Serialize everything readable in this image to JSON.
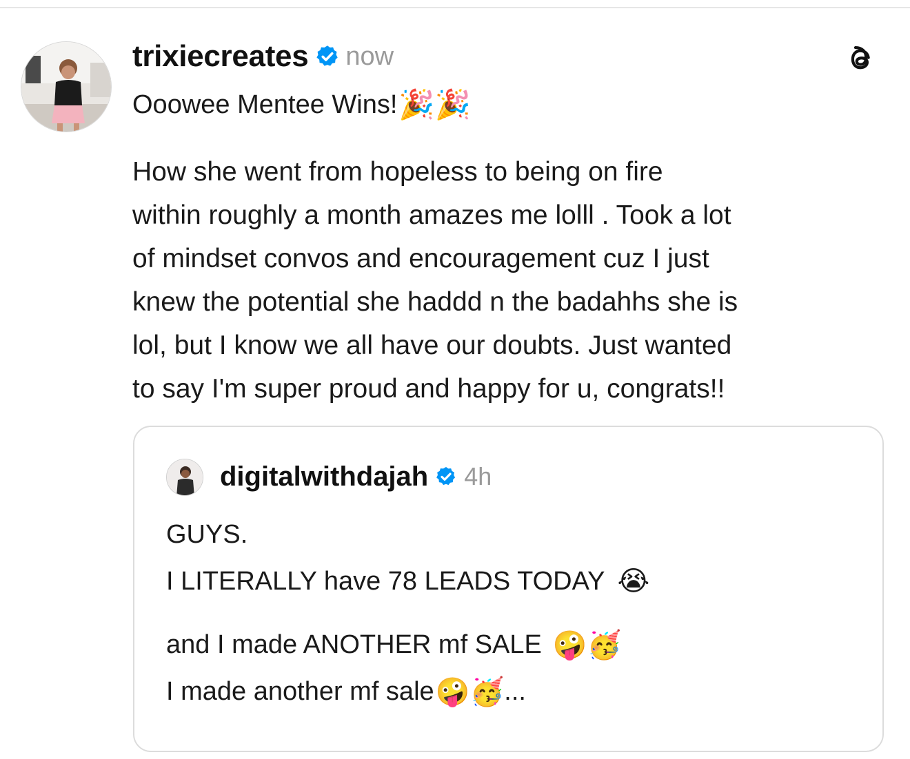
{
  "post": {
    "username": "trixiecreates",
    "timestamp": "now",
    "verified_icon": "verified-badge-icon",
    "app_icon": "threads-logo-icon",
    "headline": "Ooowee Mentee Wins!",
    "headline_emoji": "🎉🎉",
    "body_lines": [
      "How she went from hopeless to being on fire",
      "within roughly a month amazes me lolll . Took a lot",
      "of mindset convos and encouragement cuz I just",
      "knew the potential she haddd n the badahhs she is",
      "lol, but I know we all have our doubts. Just wanted",
      "to say I'm super proud and happy for u, congrats!!"
    ]
  },
  "quoted_post": {
    "username": "digitalwithdajah",
    "timestamp": "4h",
    "lines": [
      {
        "text": "GUYS.",
        "emoji": ""
      },
      {
        "text": "I LITERALLY have 78 LEADS TODAY",
        "emoji": "😭"
      },
      {
        "text": "and I made ANOTHER mf SALE",
        "emoji": "🤪🥳"
      },
      {
        "text": "I made another mf sale",
        "emoji": "🤪🥳",
        "suffix": "..."
      }
    ]
  },
  "colors": {
    "verified_blue": "#0095f6",
    "muted_text": "#9a9a9a",
    "border": "#dcdcdc"
  }
}
